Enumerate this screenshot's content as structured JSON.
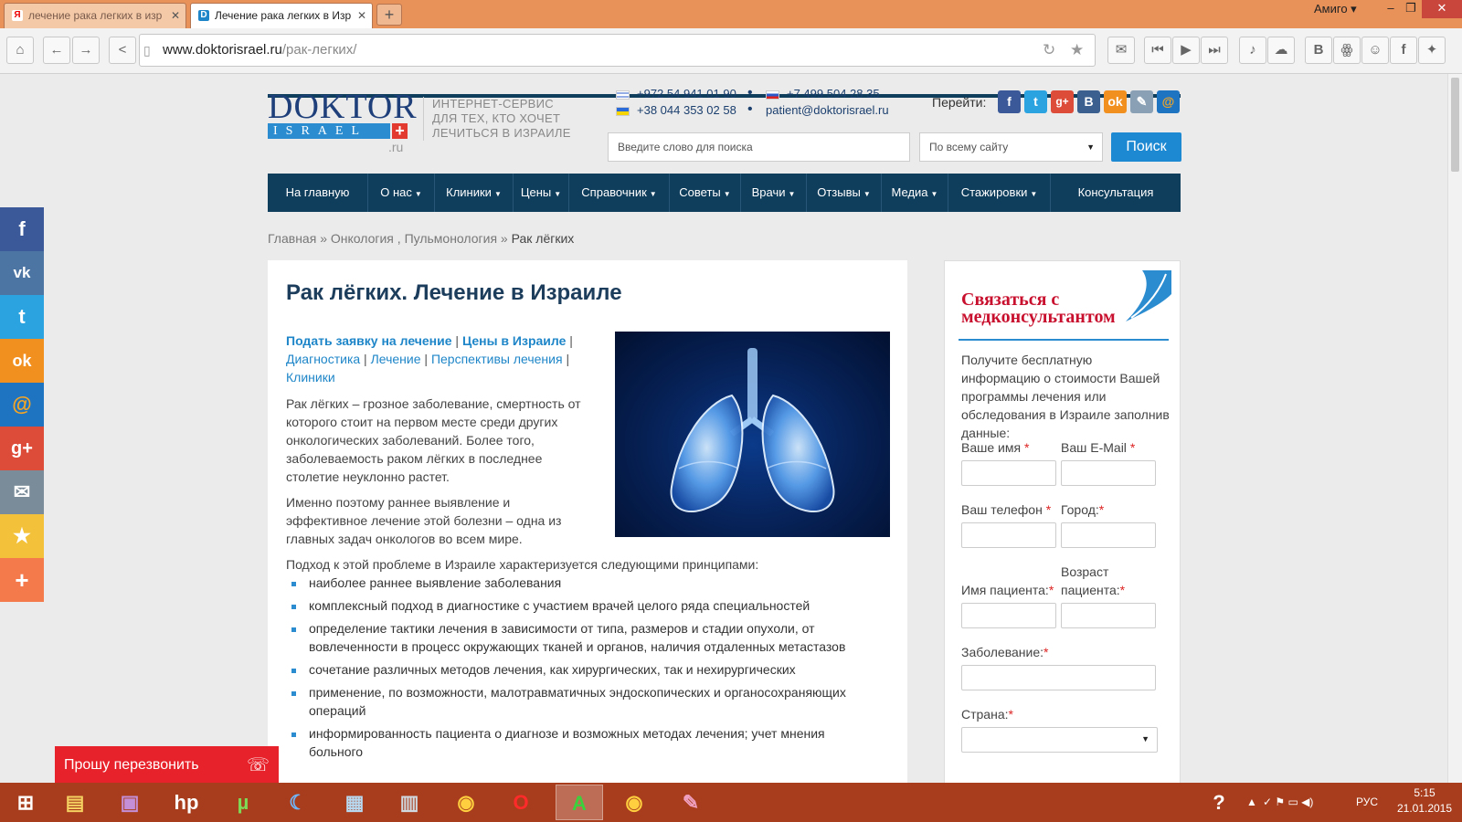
{
  "browser": {
    "tabs": [
      {
        "favicon": "Я",
        "title": "лечение рака легких в изр"
      },
      {
        "favicon": "D",
        "title": "Лечение рака легких в Изр"
      }
    ],
    "new_tab": "+",
    "window_title": "Амиго ▾",
    "url_domain": "www.doktorisrael.ru",
    "url_path": "/рак-легких/"
  },
  "site": {
    "logo_word": "DOKTOR",
    "logo_bar": "ISRAEL",
    "logo_ru": ".ru",
    "tagline": [
      "ИНТЕРНЕТ-СЕРВИС",
      "ДЛЯ ТЕХ, КТО ХОЧЕТ",
      "ЛЕЧИТЬСЯ В ИЗРАИЛЕ"
    ],
    "phones": {
      "il": "+972 54 941 01 90",
      "ru": "+7 499 504 28 35",
      "ua": "+38 044 353 02 58",
      "email": "patient@doktorisrael.ru"
    },
    "goto_label": "Перейти:",
    "search": {
      "placeholder": "Введите слово для поиска",
      "scope": "По всему сайту",
      "button": "Поиск"
    },
    "nav": [
      "На главную",
      "О нас",
      "Клиники",
      "Цены",
      "Справочник",
      "Советы",
      "Врачи",
      "Отзывы",
      "Медиа",
      "Стажировки",
      "Консультация"
    ],
    "breadcrumb": {
      "home": "Главная",
      "sep": "»",
      "onco": "Онкология",
      "pulmo": "Пульмонология",
      "current": "Рак лёгких"
    }
  },
  "article": {
    "title": "Рак лёгких. Лечение в Израиле",
    "links": {
      "apply": "Подать заявку на лечение",
      "prices": "Цены в Израиле",
      "diag": "Диагностика",
      "treat": "Лечение",
      "prospects": "Перспективы лечения",
      "clinics": "Клиники"
    },
    "p1": "Рак лёгких – грозное заболевание, смертность от которого стоит на первом месте среди других онкологических заболеваний.  Более того, заболеваемость раком лёгких в последнее столетие неуклонно растет.",
    "p2": "Именно поэтому раннее выявление и эффективное лечение этой болезни – одна из главных задач онкологов во всем мире.",
    "p3": "Подход к этой проблеме в Израиле характеризуется следующими принципами:",
    "principles": [
      "наиболее раннее выявление заболевания",
      "комплексный подход в диагностике с участием врачей целого ряда специальностей",
      "определение тактики лечения в зависимости от типа, размеров  и стадии опухоли, от вовлеченности в процесс окружающих тканей и органов, наличия отдаленных метастазов",
      "сочетание различных методов лечения, как хирургических, так и нехирургических",
      "применение, по возможности,  малотравматичных эндоскопических и органосохраняющих операций",
      "информированность пациента о диагнозе и возможных методах лечения;  учет мнения больного"
    ]
  },
  "contact_form": {
    "title_line1": "Связаться с",
    "title_line2": "медконсультантом",
    "description": "Получите бесплатную информацию о стоимости Вашей программы лечения или обследования в Израиле заполнив данные:",
    "name_label": "Ваше имя",
    "email_label": "Ваш E-Mail",
    "phone_label": "Ваш телефон",
    "city_label": "Город:",
    "patient_name_label": "Имя пациента:",
    "patient_age_label1": "Возраст",
    "patient_age_label2": "пациента:",
    "disease_label": "Заболевание:",
    "country_label": "Страна:",
    "required_mark": "*"
  },
  "share_bar": [
    "f",
    "vk",
    "t",
    "ok",
    "@",
    "g+",
    "✉",
    "★",
    "+"
  ],
  "callback": {
    "label": "Прошу перезвонить"
  },
  "taskbar": {
    "language": "РУС",
    "time": "5:15",
    "date": "21.01.2015"
  },
  "colors": {
    "tabbar": "#e8925a",
    "nav": "#0f3d5c",
    "link": "#1e86c8",
    "accent_red": "#c8102e",
    "taskbar": "#a73d1c"
  }
}
